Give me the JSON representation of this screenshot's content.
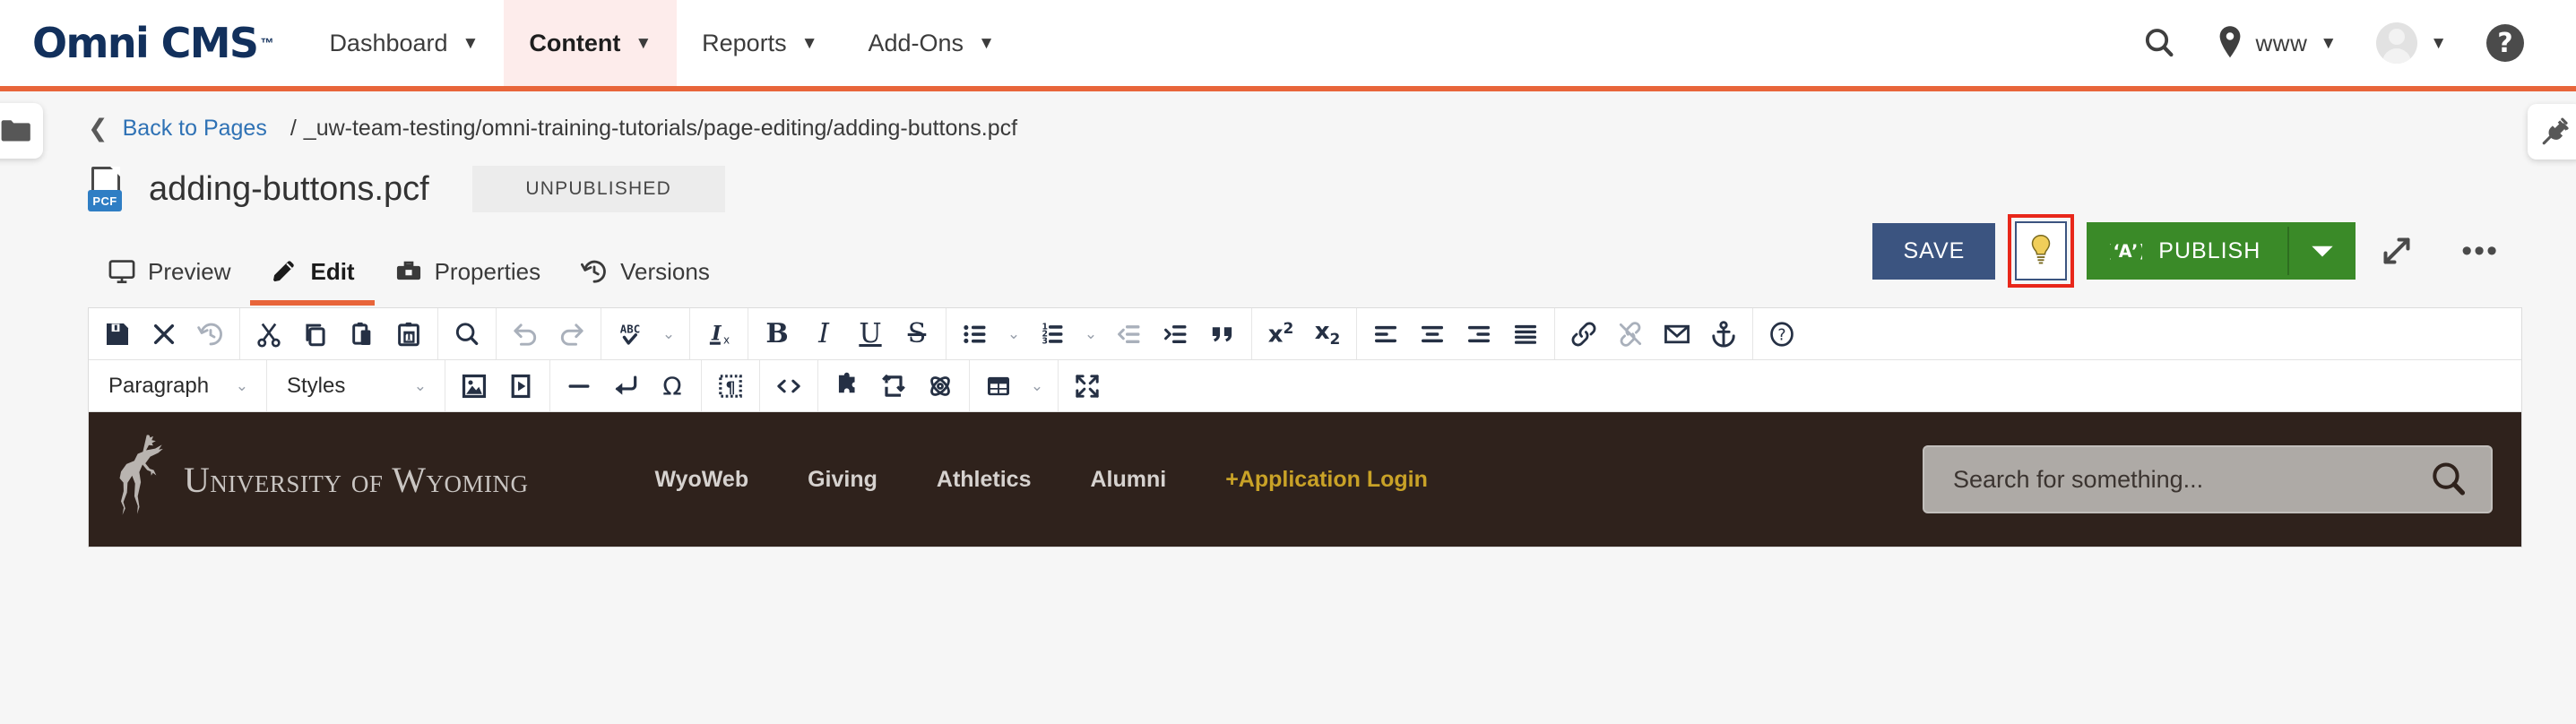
{
  "header": {
    "brand": "Omni CMS",
    "brand_tm": "™",
    "nav": [
      {
        "label": "Dashboard",
        "active": false,
        "icon": "chevron-down-icon"
      },
      {
        "label": "Content",
        "active": true,
        "icon": "chevron-down-icon"
      },
      {
        "label": "Reports",
        "active": false,
        "icon": "chevron-down-icon"
      },
      {
        "label": "Add-Ons",
        "active": false,
        "icon": "chevron-down-icon"
      }
    ],
    "search_icon": "search-icon",
    "site_icon": "location-pin-icon",
    "site_label": "www",
    "avatar_icon": "avatar-icon",
    "help_label": "?",
    "accent_color": "#e8653a",
    "brand_color": "#12305c"
  },
  "side_tabs": {
    "left_icon": "folder-icon",
    "right_icon": "plug-icon"
  },
  "breadcrumb": {
    "back_chevron": "chevron-left-icon",
    "back_label": "Back to Pages",
    "separator": "/",
    "path": "_uw-team-testing/omni-training-tutorials/page-editing/adding-buttons.pcf"
  },
  "title_bar": {
    "file_icon": "pcf-file-icon",
    "file_badge": "PCF",
    "title": "adding-buttons.pcf",
    "status_badge": "UNPUBLISHED"
  },
  "tabs": [
    {
      "label": "Preview",
      "icon": "monitor-icon",
      "active": false
    },
    {
      "label": "Edit",
      "icon": "pencil-icon",
      "active": true
    },
    {
      "label": "Properties",
      "icon": "toolbox-icon",
      "active": false
    },
    {
      "label": "Versions",
      "icon": "history-icon",
      "active": false
    }
  ],
  "actions": {
    "save_label": "SAVE",
    "save_color": "#3b5480",
    "lightbulb_icon": "lightbulb-icon",
    "lightbulb_highlight_color": "#e8271a",
    "publish_label": "PUBLISH",
    "publish_icon": "broadcast-icon",
    "publish_color": "#3a8a28",
    "publish_caret": "caret-down-icon",
    "expand_icon": "expand-arrows-icon",
    "more_icon": "ellipsis-icon"
  },
  "toolbar_row1": [
    {
      "group": [
        {
          "name": "save-icon",
          "glyph": "save"
        },
        {
          "name": "close-icon",
          "glyph": "x"
        },
        {
          "name": "revert-history-icon",
          "glyph": "revert",
          "muted": true
        }
      ]
    },
    {
      "group": [
        {
          "name": "cut-icon",
          "glyph": "scissors"
        },
        {
          "name": "copy-icon",
          "glyph": "copy"
        },
        {
          "name": "paste-icon",
          "glyph": "paste"
        },
        {
          "name": "paste-as-text-icon",
          "glyph": "paste-text"
        }
      ]
    },
    {
      "group": [
        {
          "name": "find-replace-icon",
          "glyph": "search"
        }
      ]
    },
    {
      "group": [
        {
          "name": "undo-icon",
          "glyph": "undo",
          "muted": true
        },
        {
          "name": "redo-icon",
          "glyph": "redo",
          "muted": true
        }
      ]
    },
    {
      "group": [
        {
          "name": "spellcheck-icon",
          "glyph": "abc-check"
        },
        {
          "name": "spellcheck-chevron-icon",
          "glyph": "chevron"
        }
      ]
    },
    {
      "group": [
        {
          "name": "remove-format-icon",
          "glyph": "clear-format"
        }
      ]
    },
    {
      "group": [
        {
          "name": "bold-icon",
          "glyph": "B"
        },
        {
          "name": "italic-icon",
          "glyph": "I"
        },
        {
          "name": "underline-icon",
          "glyph": "U"
        },
        {
          "name": "strikethrough-icon",
          "glyph": "S"
        }
      ]
    },
    {
      "group": [
        {
          "name": "bullet-list-icon",
          "glyph": "ul"
        },
        {
          "name": "bullet-list-chevron-icon",
          "glyph": "chevron"
        },
        {
          "name": "numbered-list-icon",
          "glyph": "ol"
        },
        {
          "name": "numbered-list-chevron-icon",
          "glyph": "chevron"
        },
        {
          "name": "decrease-indent-icon",
          "glyph": "outdent",
          "muted": true
        },
        {
          "name": "increase-indent-icon",
          "glyph": "indent"
        },
        {
          "name": "blockquote-icon",
          "glyph": "quote"
        }
      ]
    },
    {
      "group": [
        {
          "name": "superscript-icon",
          "glyph": "sup"
        },
        {
          "name": "subscript-icon",
          "glyph": "sub"
        }
      ]
    },
    {
      "group": [
        {
          "name": "align-left-icon",
          "glyph": "align-left"
        },
        {
          "name": "align-center-icon",
          "glyph": "align-center"
        },
        {
          "name": "align-right-icon",
          "glyph": "align-right"
        },
        {
          "name": "align-justify-icon",
          "glyph": "align-justify"
        }
      ]
    },
    {
      "group": [
        {
          "name": "insert-link-icon",
          "glyph": "link"
        },
        {
          "name": "unlink-icon",
          "glyph": "unlink",
          "muted": true
        },
        {
          "name": "email-link-icon",
          "glyph": "envelope"
        },
        {
          "name": "anchor-icon",
          "glyph": "anchor"
        }
      ]
    },
    {
      "group": [
        {
          "name": "help-icon",
          "glyph": "question"
        }
      ]
    }
  ],
  "toolbar_row2": {
    "paragraph_select": "Paragraph",
    "styles_select": "Styles",
    "groups": [
      {
        "group": [
          {
            "name": "insert-image-icon",
            "glyph": "image"
          },
          {
            "name": "insert-media-icon",
            "glyph": "video"
          }
        ]
      },
      {
        "group": [
          {
            "name": "horizontal-rule-icon",
            "glyph": "hr"
          },
          {
            "name": "line-break-icon",
            "glyph": "enter"
          },
          {
            "name": "special-character-icon",
            "glyph": "omega"
          }
        ]
      },
      {
        "group": [
          {
            "name": "show-blocks-icon",
            "glyph": "pilcrow-box"
          }
        ]
      },
      {
        "group": [
          {
            "name": "source-code-icon",
            "glyph": "code"
          }
        ]
      },
      {
        "group": [
          {
            "name": "insert-snippet-icon",
            "glyph": "puzzle"
          },
          {
            "name": "insert-asset-icon",
            "glyph": "asset"
          },
          {
            "name": "insert-component-icon",
            "glyph": "atom"
          }
        ]
      },
      {
        "group": [
          {
            "name": "insert-table-icon",
            "glyph": "table"
          },
          {
            "name": "table-chevron-icon",
            "glyph": "chevron"
          }
        ]
      },
      {
        "group": [
          {
            "name": "fullscreen-icon",
            "glyph": "fullscreen"
          }
        ]
      }
    ]
  },
  "preview": {
    "bg_color": "#2f221c",
    "logo_icon": "bucking-horse-icon",
    "logo_text_1": "U",
    "logo_text_2": "NIVERSITY",
    "logo_text_of": "OF",
    "logo_text_3": "W",
    "logo_text_4": "YOMING",
    "nav": [
      {
        "label": "WyoWeb",
        "gold": false
      },
      {
        "label": "Giving",
        "gold": false
      },
      {
        "label": "Athletics",
        "gold": false
      },
      {
        "label": "Alumni",
        "gold": false
      },
      {
        "label": "+Application Login",
        "gold": true
      }
    ],
    "search_placeholder": "Search for something...",
    "search_icon": "search-icon",
    "gold_color": "#c9a227"
  }
}
